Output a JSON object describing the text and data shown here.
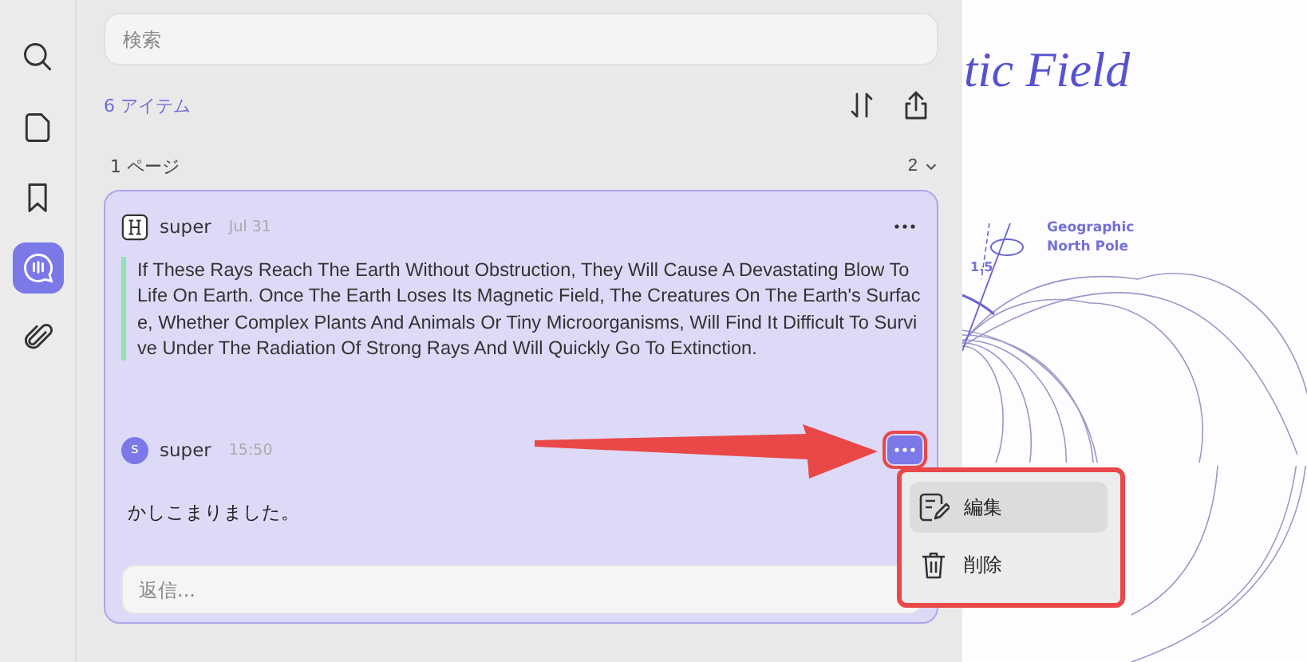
{
  "sidebar": {
    "items": [
      {
        "kind": "search",
        "selected": false
      },
      {
        "kind": "page",
        "selected": false
      },
      {
        "kind": "bookmark",
        "selected": false
      },
      {
        "kind": "comment",
        "selected": true
      },
      {
        "kind": "attachment",
        "selected": false
      }
    ]
  },
  "search": {
    "placeholder": "検索"
  },
  "item_count": "6 アイテム",
  "page_group": {
    "label": "1 ページ",
    "count": "2",
    "expanded": true
  },
  "comment": {
    "author": "super",
    "date": "Jul 31",
    "quote": "If These Rays Reach The Earth Without Obstruction, They Will Cause A Devastating Blow To Life On Earth. Once The Earth Loses Its Magnetic Field, The Creatures On The Earth's Surface, Whether Complex Plants And Animals Or Tiny Microorganisms, Will Find It Difficult To Survive Under The Radiation Of Strong Rays And Will Quickly Go To Extinction.",
    "replies": [
      {
        "author": "super",
        "avatar_letter": "s",
        "time": "15:50",
        "text": "かしこまりました。",
        "menu_open": true
      }
    ],
    "reply_field": {
      "placeholder": "返信..."
    }
  },
  "context_menu": {
    "items": [
      {
        "kind": "edit",
        "label": "編集",
        "selected": true
      },
      {
        "kind": "delete",
        "label": "削除",
        "selected": false
      }
    ]
  },
  "document": {
    "title_fragment": "tic Field",
    "angle_label": "1.5",
    "pole_label": "Geographic North Pole"
  }
}
